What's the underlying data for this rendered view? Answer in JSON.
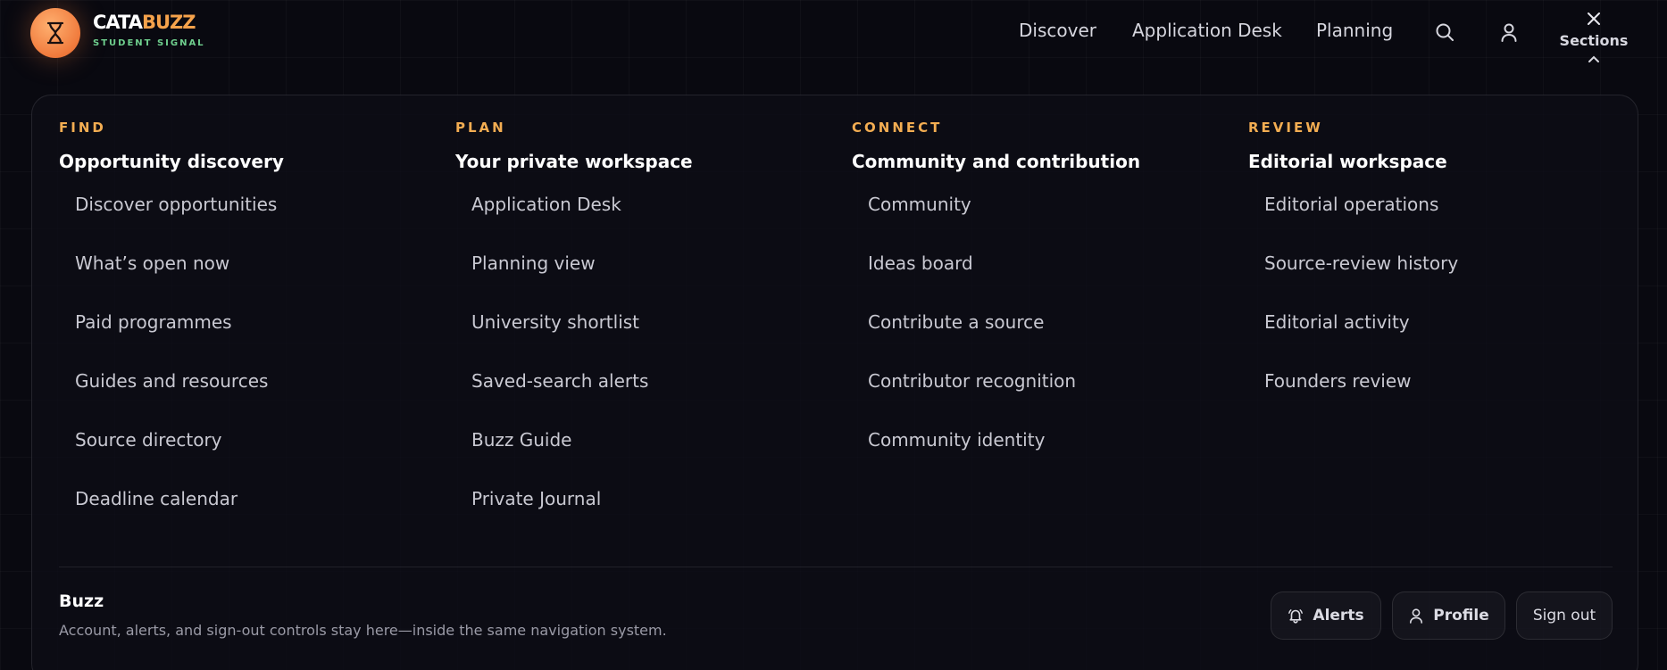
{
  "brand": {
    "name_a": "CATA",
    "name_b": "BUZZ",
    "tagline": "STUDENT SIGNAL"
  },
  "nav": {
    "discover": "Discover",
    "application_desk": "Application Desk",
    "planning": "Planning"
  },
  "sections_toggle": {
    "label": "Sections"
  },
  "columns": [
    {
      "eyebrow": "FIND",
      "title": "Opportunity discovery",
      "links": [
        "Discover opportunities",
        "What’s open now",
        "Paid programmes",
        "Guides and resources",
        "Source directory",
        "Deadline calendar"
      ]
    },
    {
      "eyebrow": "PLAN",
      "title": "Your private workspace",
      "links": [
        "Application Desk",
        "Planning view",
        "University shortlist",
        "Saved-search alerts",
        "Buzz Guide",
        "Private Journal"
      ]
    },
    {
      "eyebrow": "CONNECT",
      "title": "Community and contribution",
      "links": [
        "Community",
        "Ideas board",
        "Contribute a source",
        "Contributor recognition",
        "Community identity"
      ]
    },
    {
      "eyebrow": "REVIEW",
      "title": "Editorial workspace",
      "links": [
        "Editorial operations",
        "Source-review history",
        "Editorial activity",
        "Founders review"
      ]
    }
  ],
  "footer": {
    "title": "Buzz",
    "description": "Account, alerts, and sign-out controls stay here—inside the same navigation system.",
    "alerts_label": "Alerts",
    "profile_label": "Profile",
    "signout_label": "Sign out"
  },
  "colors": {
    "accent": "#f3ad52",
    "brand_orange": "#f07a3c",
    "tag_green": "#6fcf8e",
    "background": "#090910"
  },
  "icons": [
    "hourglass-icon",
    "search-icon",
    "user-icon",
    "close-icon",
    "chevron-up-icon",
    "bell-icon",
    "user-icon"
  ]
}
